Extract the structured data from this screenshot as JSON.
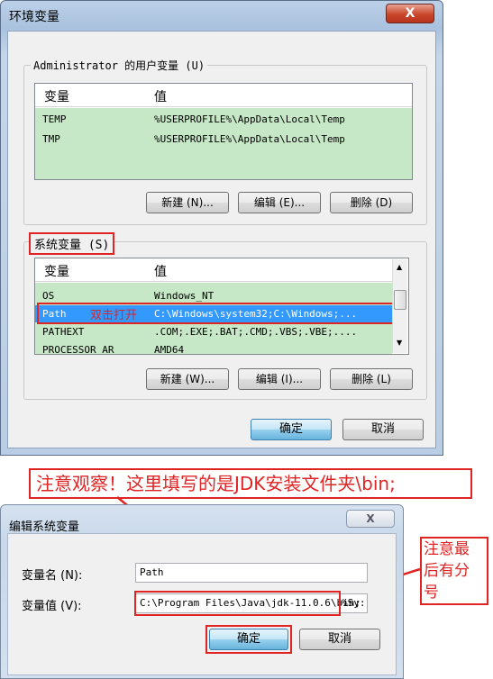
{
  "env_window": {
    "title": "环境变量",
    "close_glyph": "X",
    "user_group_label": "Administrator 的用户变量 (U)",
    "user_vars": {
      "columns": [
        "变量",
        "值"
      ],
      "rows": [
        {
          "name": "TEMP",
          "value": "%USERPROFILE%\\AppData\\Local\\Temp"
        },
        {
          "name": "TMP",
          "value": "%USERPROFILE%\\AppData\\Local\\Temp"
        }
      ]
    },
    "user_buttons": {
      "new": "新建 (N)...",
      "edit": "编辑 (E)...",
      "delete": "删除 (D)"
    },
    "system_group_label": "系统变量 (S)",
    "system_vars": {
      "columns": [
        "变量",
        "值"
      ],
      "rows": [
        {
          "name": "OS",
          "value": "Windows_NT"
        },
        {
          "name": "Path",
          "value": "C:\\Windows\\system32;C:\\Windows;..."
        },
        {
          "name": "PATHEXT",
          "value": ".COM;.EXE;.BAT;.CMD;.VBS;.VBE;...."
        },
        {
          "name": "PROCESSOR_AR",
          "value": "AMD64"
        }
      ]
    },
    "system_buttons": {
      "new": "新建 (W)...",
      "edit": "编辑 (I)...",
      "delete": "删除 (L)"
    },
    "ok": "确定",
    "cancel": "取消"
  },
  "annotations": {
    "double_click": "双击打开",
    "observe": "注意观察！这里填写的是JDK安装文件夹\\bin;",
    "semicolon": [
      "注意最",
      "后有分",
      "号"
    ]
  },
  "edit_window": {
    "title": "编辑系统变量",
    "close_glyph": "X",
    "name_label": "变量名 (N):",
    "name_value": "Path",
    "value_label": "变量值 (V):",
    "value_text": "C:\\Program Files\\Java\\jdk-11.0.6\\bin;",
    "value_rest": "%Sy:",
    "ok": "确定",
    "cancel": "取消"
  },
  "colors": {
    "annotation_red": "#e02424",
    "selection_blue": "#3399ff",
    "list_green": "#c6e8c6"
  }
}
